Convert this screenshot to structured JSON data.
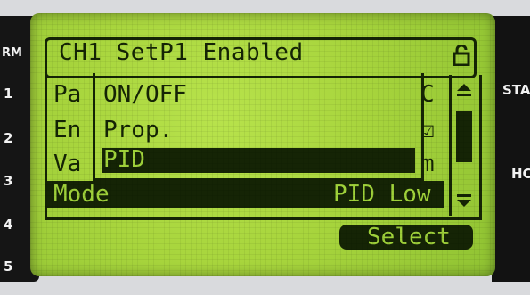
{
  "left_labels": [
    "RM",
    "1",
    "2",
    "3",
    "4",
    "5"
  ],
  "right_labels": [
    "STA",
    "HC"
  ],
  "lcd": {
    "title": "CH1 SetP1 Enabled",
    "lock_icon": "lock-icon",
    "background_color": "#a8d53d",
    "pixel_color": "#152405",
    "underlying_rows": [
      {
        "label": "Pa",
        "right": "C"
      },
      {
        "label": "En",
        "right": "☑"
      },
      {
        "label": "Va",
        "right": "m"
      }
    ],
    "popup_items": [
      "ON/OFF",
      "Prop.",
      "PID"
    ],
    "popup_selected_index": 2,
    "mode_row": {
      "label": "Mode",
      "value": "PID Low"
    },
    "softkey_label": "Select"
  }
}
